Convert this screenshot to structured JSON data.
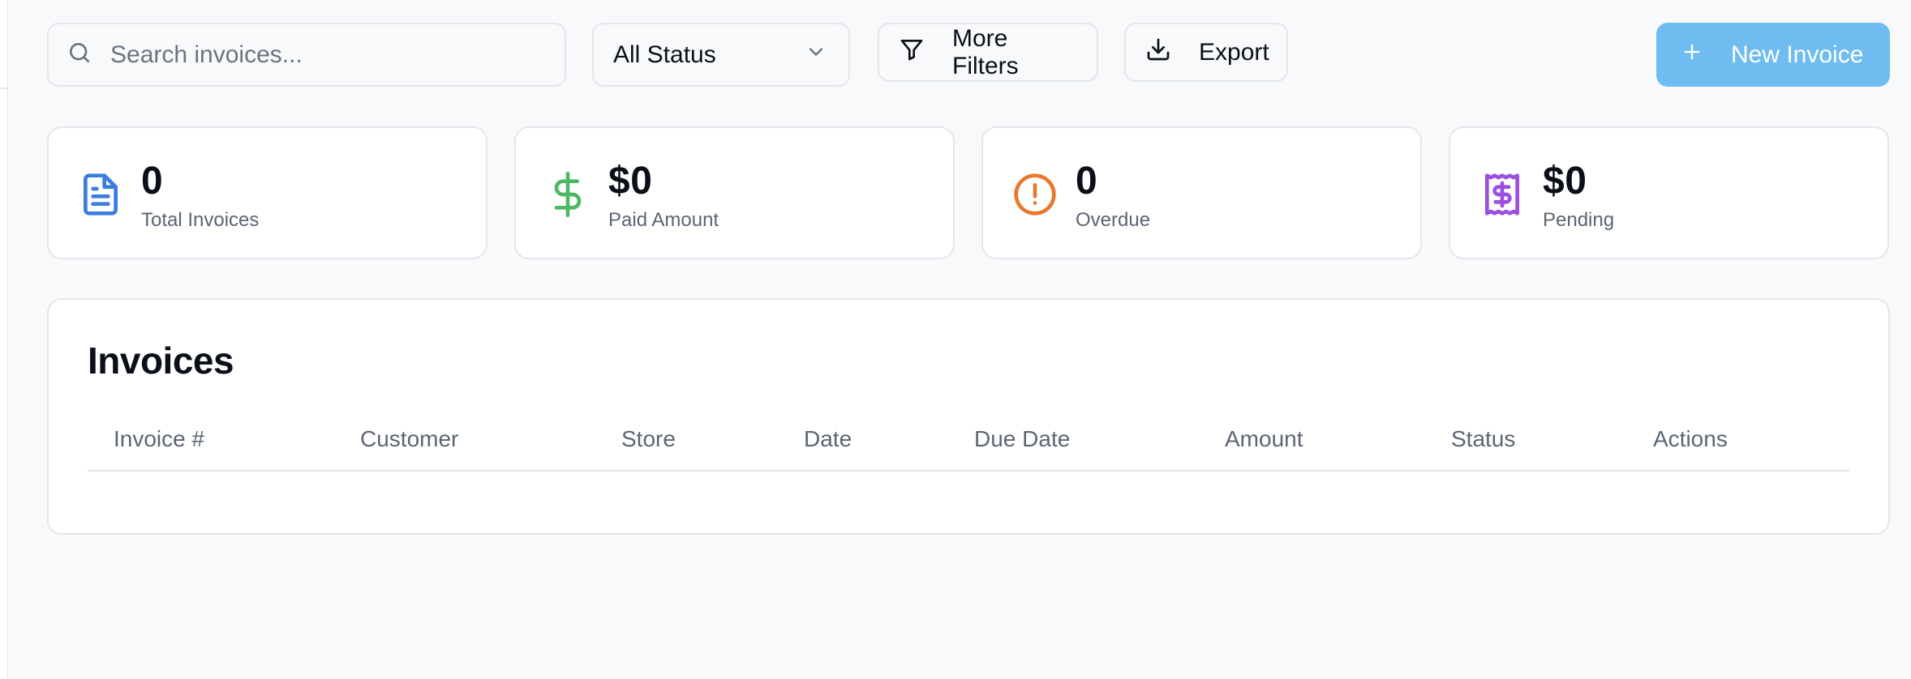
{
  "search": {
    "placeholder": "Search invoices...",
    "value": ""
  },
  "filters": {
    "status_selected": "All Status",
    "more_filters_label": "More Filters",
    "export_label": "Export",
    "new_invoice_label": "New Invoice"
  },
  "stats": [
    {
      "value": "0",
      "label": "Total Invoices",
      "icon": "file-text-icon",
      "color": "#3b7ddd"
    },
    {
      "value": "$0",
      "label": "Paid Amount",
      "icon": "dollar-icon",
      "color": "#4cb865"
    },
    {
      "value": "0",
      "label": "Overdue",
      "icon": "alert-circle-icon",
      "color": "#e8782e"
    },
    {
      "value": "$0",
      "label": "Pending",
      "icon": "receipt-icon",
      "color": "#9b4fe0"
    }
  ],
  "invoices": {
    "title": "Invoices",
    "columns": [
      "Invoice #",
      "Customer",
      "Store",
      "Date",
      "Due Date",
      "Amount",
      "Status",
      "Actions"
    ],
    "rows": []
  },
  "colors": {
    "primary": "#6fbdf0",
    "background": "#f8f9fb",
    "border": "#e3e6ea",
    "muted_text": "#5b6575"
  }
}
